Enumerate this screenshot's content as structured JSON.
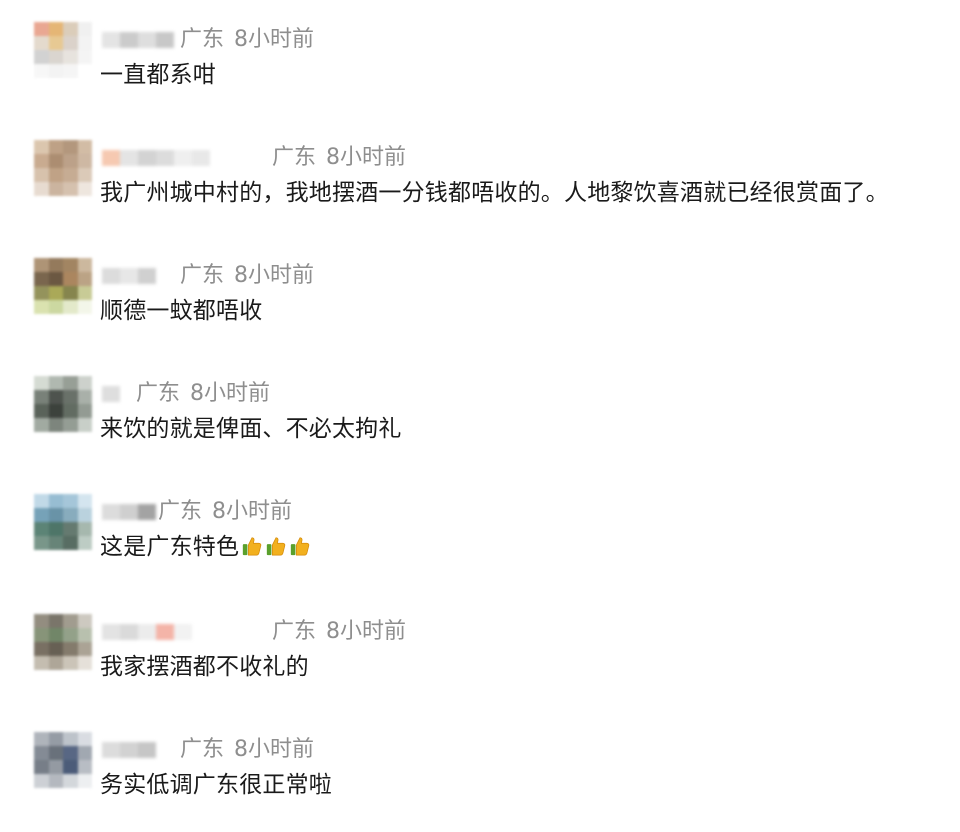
{
  "comments": [
    {
      "region": "广东",
      "time": "8小时前",
      "text": "一直都系咁",
      "emoji_count": 0,
      "avatar_colors": [
        "#e8a089",
        "#e3b06a",
        "#d9c9b5",
        "#efefef",
        "#e2d7c9",
        "#e6c58a",
        "#d8cfc6",
        "#f2f2f2",
        "#cfcfcf",
        "#d7d2cc",
        "#e6e1dc",
        "#f4f4f4",
        "#f7f7f7",
        "#f2f2f2",
        "#f5f5f5",
        "#ffffff"
      ],
      "name_colors": [
        "#e4e4e4",
        "#cbcbcb",
        "#dedede",
        "#c8c8c8"
      ]
    },
    {
      "region": "广东",
      "time": "8小时前",
      "text": "我广州城中村的，我地摆酒一分钱都唔收的。人地黎饮喜酒就已经很赏面了。",
      "emoji_count": 0,
      "avatar_colors": [
        "#d9c2a8",
        "#b99a7c",
        "#ad8f73",
        "#cfb79e",
        "#c5a487",
        "#a58466",
        "#b79a7f",
        "#cab29c",
        "#d4bda6",
        "#bb9b7c",
        "#c2a58a",
        "#d8c6b3",
        "#e6d9cd",
        "#c7ae97",
        "#d2bca8",
        "#ede4dc"
      ],
      "name_colors": [
        "#f6c9b1",
        "#e4e4e4",
        "#d3d3d3",
        "#dcdcdc",
        "#efefef",
        "#e8e8e8"
      ]
    },
    {
      "region": "广东",
      "time": "8小时前",
      "text": "顺德一蚊都唔收",
      "emoji_count": 0,
      "avatar_colors": [
        "#a88b6b",
        "#8b6f4f",
        "#9b7b55",
        "#c8b296",
        "#6f5a3f",
        "#5f4a33",
        "#a47c52",
        "#b69c7b",
        "#8c8a4f",
        "#a3a24a",
        "#7c7b3f",
        "#c4c78e",
        "#d7e0a9",
        "#c8d59a",
        "#e1e8c6",
        "#f3f6e8"
      ],
      "name_colors": [
        "#dcdcdc",
        "#e7e7e7",
        "#d0d0d0"
      ]
    },
    {
      "region": "广东",
      "time": "8小时前",
      "text": "来饮的就是俾面、不必太拘礼",
      "emoji_count": 0,
      "avatar_colors": [
        "#d2d8d0",
        "#aab3aa",
        "#8f978e",
        "#c9cec8",
        "#6e776e",
        "#3f453f",
        "#5d655d",
        "#a2aaa2",
        "#4d564d",
        "#2c322c",
        "#556055",
        "#8a938a",
        "#9aa39a",
        "#727b72",
        "#8c958c",
        "#c4cbc4"
      ],
      "name_colors": [
        "#dedede"
      ]
    },
    {
      "region": "广东",
      "time": "8小时前",
      "text": "这是广东特色",
      "emoji_count": 3,
      "avatar_colors": [
        "#bcd6e6",
        "#8fb8cf",
        "#9ec2d6",
        "#d1e3ee",
        "#6b9bb3",
        "#5d8aa0",
        "#7ea5b8",
        "#b5cfdc",
        "#4f7a6b",
        "#3f6a5c",
        "#586f64",
        "#9fb2a8",
        "#6e8e80",
        "#5b7a6d",
        "#4a6156",
        "#b8c8bf"
      ],
      "name_colors": [
        "#dcdcdc",
        "#cfcfcf",
        "#a3a3a3"
      ]
    },
    {
      "region": "广东",
      "time": "8小时前",
      "text": "我家摆酒都不收礼的",
      "emoji_count": 0,
      "avatar_colors": [
        "#8a8476",
        "#6f6a5e",
        "#9a9486",
        "#c9c5bb",
        "#7d8b6e",
        "#667c5c",
        "#8a9a80",
        "#b3bba8",
        "#6e6456",
        "#5b5346",
        "#7a7060",
        "#a49c8d",
        "#bfb8aa",
        "#a89f90",
        "#c7c0b3",
        "#e3ded6"
      ],
      "name_colors": [
        "#e3e3e3",
        "#dadada",
        "#ececec",
        "#f4b4a8",
        "#f2f2f2"
      ]
    },
    {
      "region": "广东",
      "time": "8小时前",
      "text": "务实低调广东很正常啦",
      "emoji_count": 0,
      "avatar_colors": [
        "#a9aeb6",
        "#8d949e",
        "#b8bec6",
        "#d6dae0",
        "#7a828d",
        "#5d6570",
        "#4a5b7a",
        "#9aa1ab",
        "#6c747e",
        "#8b929b",
        "#3d4f6e",
        "#b3b8bf",
        "#c9cdd2",
        "#aeb3ba",
        "#d0d4d9",
        "#eceef0"
      ],
      "name_colors": [
        "#dcdcdc",
        "#d2d2d2",
        "#c6c6c6"
      ]
    }
  ]
}
